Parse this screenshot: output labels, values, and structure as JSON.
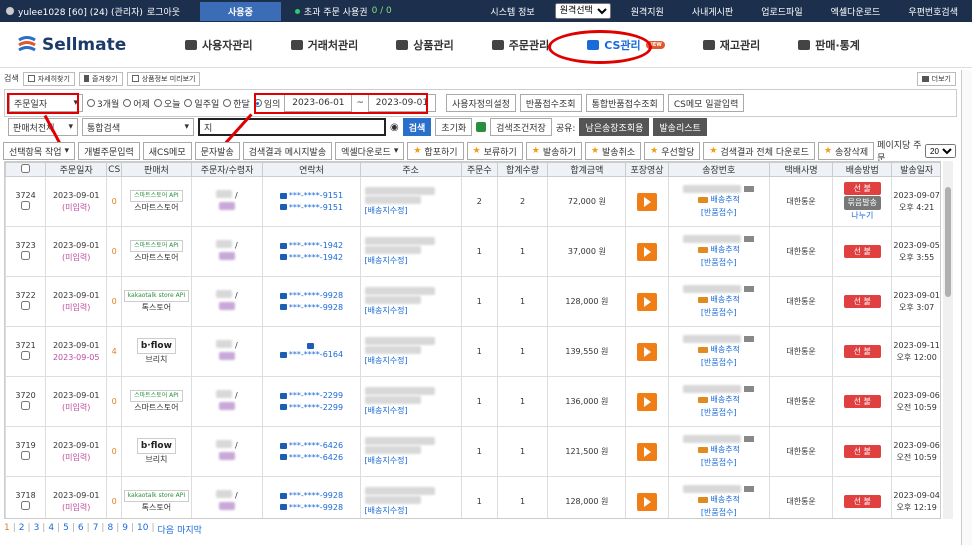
{
  "topbar": {
    "user": "yulee1028 [60] (24) (관리자)",
    "logout": "로그아웃",
    "status": "사용중",
    "excess_label": "초과 주문 사용권",
    "excess_count": "0 / 0",
    "links": [
      "시스템 정보",
      "원격선택",
      "원격지원",
      "사내게시판",
      "업로드파일",
      "엑셀다운로드",
      "우편번호검색"
    ]
  },
  "nav": {
    "logo": "Sellmate",
    "menu": [
      "사용자관리",
      "거래처관리",
      "상품관리",
      "주문관리",
      "CS관리",
      "재고관리",
      "판매·통계"
    ],
    "new_badge": "NEW"
  },
  "search_row": {
    "label": "검색",
    "buttons": [
      "자세히찾기",
      "즐겨찾기",
      "상품정보 미리보기"
    ],
    "right_btn": "더보기"
  },
  "filter": {
    "date_type": "주문일자",
    "radios": [
      "3개월",
      "어제",
      "오늘",
      "일주일",
      "한달",
      "임의"
    ],
    "date_from": "2023-06-01",
    "date_sep": "~",
    "date_to": "2023-09-01",
    "buttons": [
      "사용자정의설정",
      "반품접수조회",
      "통합반품접수조회",
      "CS메모 일괄입력"
    ]
  },
  "filter2": {
    "shop_select": "판매처전체",
    "search_type": "통합검색",
    "search_value": "지",
    "search_btn": "검색",
    "reset_btn": "초기화",
    "save_btn": "검색조건저장",
    "share_label": "공유:",
    "share1": "남은송장조회용",
    "share2": "발송리스트"
  },
  "toolbar": {
    "items": [
      "선택항목 작업",
      "개별주문입력",
      "새CS메모",
      "문자발송",
      "검색결과 메시지발송",
      "엑셀다운로드"
    ],
    "star_items": [
      "합포하기",
      "보류하기",
      "발송하기",
      "발송취소",
      "우선할당",
      "검색결과 전체 다운로드",
      "송장삭제"
    ],
    "per_page_label": "페이지당 주문",
    "per_page": "20"
  },
  "table": {
    "headers": [
      "",
      "주문일자",
      "CS",
      "판매처",
      "주문자/수령자",
      "연락처",
      "주소",
      "주문수",
      "합계수량",
      "합계금액",
      "포장영상",
      "송장번호",
      "택배사명",
      "배송방법",
      "발송일자"
    ],
    "rows": [
      {
        "no": "3724",
        "date": "2023-09-01",
        "date2": "(미입력)",
        "cs": "0",
        "shop": "스마트스토어",
        "shop_logo": "스마트스토어 API",
        "phone1": "***-****-9151",
        "phone2": "***-****-9151",
        "addr_link": "[배송지수정]",
        "cnt": "2",
        "qty": "2",
        "amount": "72,000 원",
        "track_link": "배송추적",
        "return_link": "[반품접수]",
        "courier": "대한통운",
        "badge": "선 불",
        "badge2": "묶음발송",
        "split": "나누기",
        "ship": "2023-09-07",
        "ship_time": "오후 4:21"
      },
      {
        "no": "3723",
        "date": "2023-09-01",
        "date2": "(미입력)",
        "cs": "0",
        "shop": "스마트스토어",
        "shop_logo": "스마트스토어 API",
        "phone1": "***-****-1942",
        "phone2": "***-****-1942",
        "addr_link": "[배송지수정]",
        "cnt": "1",
        "qty": "1",
        "amount": "37,000 원",
        "track_link": "배송추적",
        "return_link": "[반품접수]",
        "courier": "대한통운",
        "badge": "선 불",
        "badge2": "",
        "split": "",
        "ship": "2023-09-05",
        "ship_time": "오후 3:55"
      },
      {
        "no": "3722",
        "date": "2023-09-01",
        "date2": "(미입력)",
        "cs": "0",
        "shop": "톡스토어",
        "shop_logo": "kakaotalk store API",
        "phone1": "***-****-9928",
        "phone2": "***-****-9928",
        "addr_link": "[배송지수정]",
        "cnt": "1",
        "qty": "1",
        "amount": "128,000 원",
        "track_link": "배송추적",
        "return_link": "[반품접수]",
        "courier": "대한통운",
        "badge": "선 불",
        "badge2": "",
        "split": "",
        "ship": "2023-09-01",
        "ship_time": "오후 3:07"
      },
      {
        "no": "3721",
        "date": "2023-09-01",
        "date2": "2023-09-05",
        "cs": "4",
        "shop": "브리치",
        "shop_logo": "b·flow",
        "phone1": "",
        "phone2": "***-****-6164",
        "addr_link": "[배송지수정]",
        "cnt": "1",
        "qty": "1",
        "amount": "139,550 원",
        "track_link": "배송추적",
        "return_link": "[반품접수]",
        "courier": "대한통운",
        "badge": "선 불",
        "badge2": "",
        "split": "",
        "ship": "2023-09-11",
        "ship_time": "오후 12:00"
      },
      {
        "no": "3720",
        "date": "2023-09-01",
        "date2": "(미입력)",
        "cs": "0",
        "shop": "스마트스토어",
        "shop_logo": "스마트스토어 API",
        "phone1": "***-****-2299",
        "phone2": "***-****-2299",
        "addr_link": "[배송지수정]",
        "cnt": "1",
        "qty": "1",
        "amount": "136,000 원",
        "track_link": "배송추적",
        "return_link": "[반품접수]",
        "courier": "대한통운",
        "badge": "선 불",
        "badge2": "",
        "split": "",
        "ship": "2023-09-06",
        "ship_time": "오전 10:59"
      },
      {
        "no": "3719",
        "date": "2023-09-01",
        "date2": "(미입력)",
        "cs": "0",
        "shop": "브리치",
        "shop_logo": "b·flow",
        "phone1": "***-****-6426",
        "phone2": "***-****-6426",
        "addr_link": "[배송지수정]",
        "cnt": "1",
        "qty": "1",
        "amount": "121,500 원",
        "track_link": "배송추적",
        "return_link": "[반품접수]",
        "courier": "대한통운",
        "badge": "선 불",
        "badge2": "",
        "split": "",
        "ship": "2023-09-06",
        "ship_time": "오전 10:59"
      },
      {
        "no": "3718",
        "date": "2023-09-01",
        "date2": "(미입력)",
        "cs": "0",
        "shop": "톡스토어",
        "shop_logo": "kakaotalk store API",
        "phone1": "***-****-9928",
        "phone2": "***-****-9928",
        "addr_link": "[배송지수정]",
        "cnt": "1",
        "qty": "1",
        "amount": "128,000 원",
        "track_link": "배송추적",
        "return_link": "[반품접수]",
        "courier": "대한통운",
        "badge": "선 불",
        "badge2": "",
        "split": "",
        "ship": "2023-09-04",
        "ship_time": "오후 12:19"
      }
    ]
  },
  "pager": {
    "pages": [
      "1",
      "2",
      "3",
      "4",
      "5",
      "6",
      "7",
      "8",
      "9",
      "10"
    ],
    "next": "다음",
    "last": "마지막"
  },
  "colors": {
    "accent": "#1a6ad8",
    "annotation": "#e00000",
    "topbar": "#1c2f4d",
    "status_btn": "#3a6db5"
  }
}
